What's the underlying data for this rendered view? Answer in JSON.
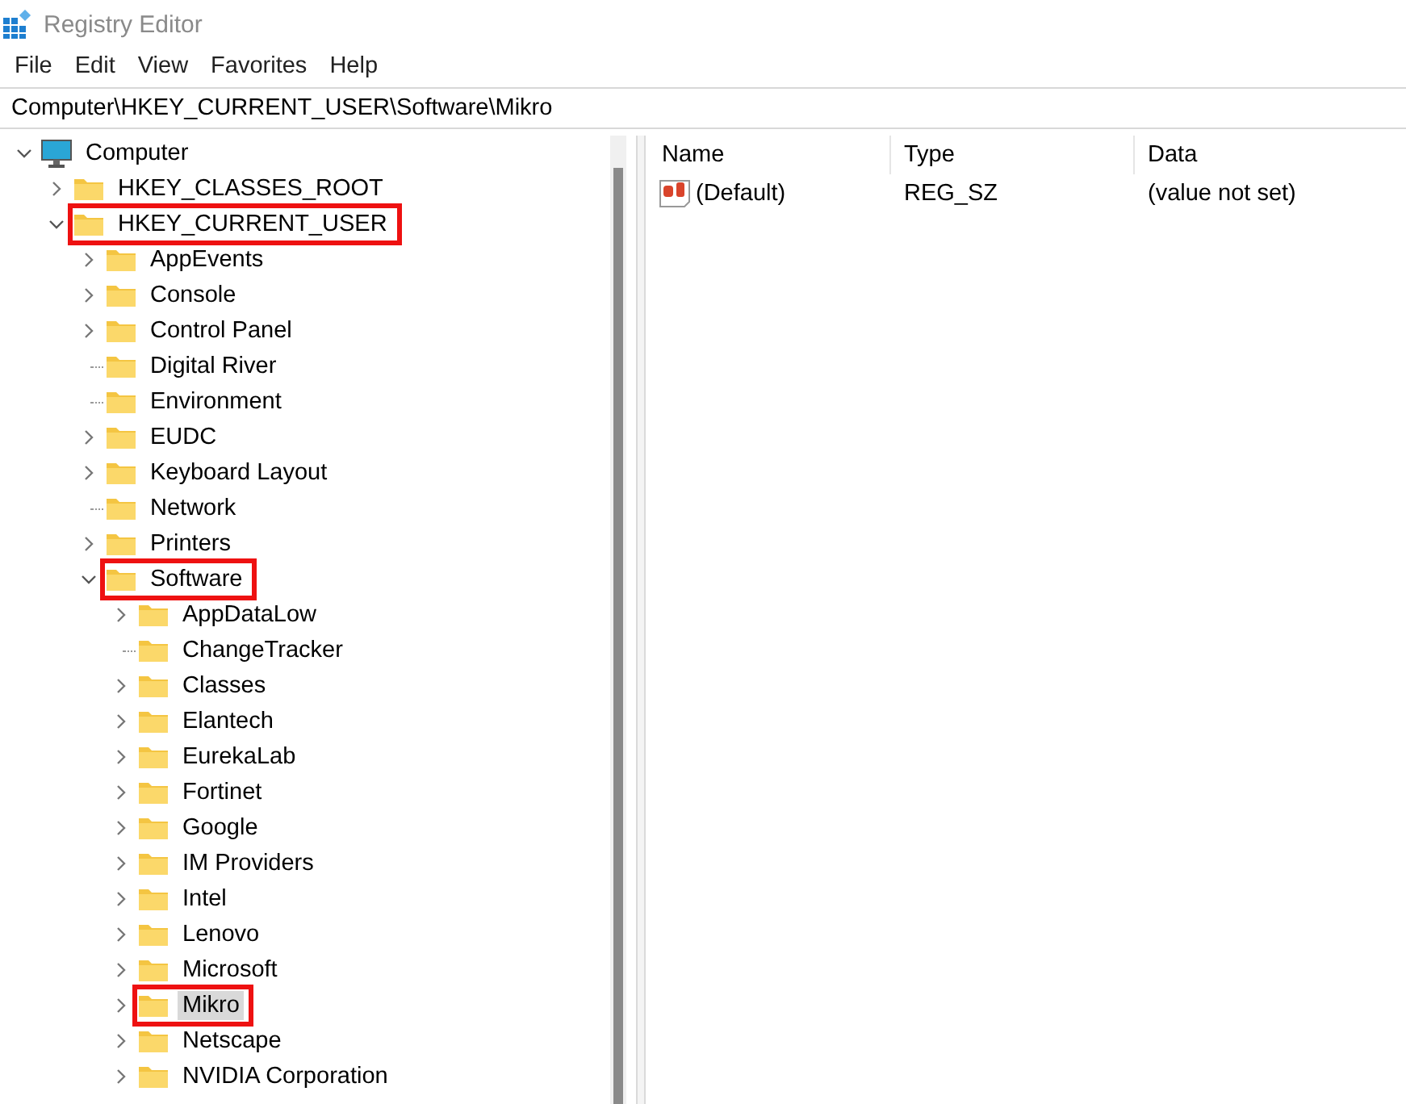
{
  "window": {
    "title": "Registry Editor"
  },
  "menu": [
    "File",
    "Edit",
    "View",
    "Favorites",
    "Help"
  ],
  "address": "Computer\\HKEY_CURRENT_USER\\Software\\Mikro",
  "tree": [
    {
      "label": "Computer",
      "kind": "computer",
      "expandable": true,
      "expanded": true,
      "selected": false,
      "highlighted": false,
      "children": [
        {
          "label": "HKEY_CLASSES_ROOT",
          "kind": "folder",
          "expandable": true,
          "expanded": false,
          "selected": false,
          "highlighted": false
        },
        {
          "label": "HKEY_CURRENT_USER",
          "kind": "folder",
          "expandable": true,
          "expanded": true,
          "selected": false,
          "highlighted": true,
          "children": [
            {
              "label": "AppEvents",
              "kind": "folder",
              "expandable": true,
              "expanded": false,
              "selected": false,
              "highlighted": false
            },
            {
              "label": "Console",
              "kind": "folder",
              "expandable": true,
              "expanded": false,
              "selected": false,
              "highlighted": false
            },
            {
              "label": "Control Panel",
              "kind": "folder",
              "expandable": true,
              "expanded": false,
              "selected": false,
              "highlighted": false
            },
            {
              "label": "Digital River",
              "kind": "folder",
              "expandable": false,
              "expanded": false,
              "selected": false,
              "highlighted": false
            },
            {
              "label": "Environment",
              "kind": "folder",
              "expandable": false,
              "expanded": false,
              "selected": false,
              "highlighted": false
            },
            {
              "label": "EUDC",
              "kind": "folder",
              "expandable": true,
              "expanded": false,
              "selected": false,
              "highlighted": false
            },
            {
              "label": "Keyboard Layout",
              "kind": "folder",
              "expandable": true,
              "expanded": false,
              "selected": false,
              "highlighted": false
            },
            {
              "label": "Network",
              "kind": "folder",
              "expandable": false,
              "expanded": false,
              "selected": false,
              "highlighted": false
            },
            {
              "label": "Printers",
              "kind": "folder",
              "expandable": true,
              "expanded": false,
              "selected": false,
              "highlighted": false
            },
            {
              "label": "Software",
              "kind": "folder",
              "expandable": true,
              "expanded": true,
              "selected": false,
              "highlighted": true,
              "children": [
                {
                  "label": "AppDataLow",
                  "kind": "folder",
                  "expandable": true,
                  "expanded": false,
                  "selected": false,
                  "highlighted": false
                },
                {
                  "label": "ChangeTracker",
                  "kind": "folder",
                  "expandable": false,
                  "expanded": false,
                  "selected": false,
                  "highlighted": false
                },
                {
                  "label": "Classes",
                  "kind": "folder",
                  "expandable": true,
                  "expanded": false,
                  "selected": false,
                  "highlighted": false
                },
                {
                  "label": "Elantech",
                  "kind": "folder",
                  "expandable": true,
                  "expanded": false,
                  "selected": false,
                  "highlighted": false
                },
                {
                  "label": "EurekaLab",
                  "kind": "folder",
                  "expandable": true,
                  "expanded": false,
                  "selected": false,
                  "highlighted": false
                },
                {
                  "label": "Fortinet",
                  "kind": "folder",
                  "expandable": true,
                  "expanded": false,
                  "selected": false,
                  "highlighted": false
                },
                {
                  "label": "Google",
                  "kind": "folder",
                  "expandable": true,
                  "expanded": false,
                  "selected": false,
                  "highlighted": false
                },
                {
                  "label": "IM Providers",
                  "kind": "folder",
                  "expandable": true,
                  "expanded": false,
                  "selected": false,
                  "highlighted": false
                },
                {
                  "label": "Intel",
                  "kind": "folder",
                  "expandable": true,
                  "expanded": false,
                  "selected": false,
                  "highlighted": false
                },
                {
                  "label": "Lenovo",
                  "kind": "folder",
                  "expandable": true,
                  "expanded": false,
                  "selected": false,
                  "highlighted": false
                },
                {
                  "label": "Microsoft",
                  "kind": "folder",
                  "expandable": true,
                  "expanded": false,
                  "selected": false,
                  "highlighted": false
                },
                {
                  "label": "Mikro",
                  "kind": "folder",
                  "expandable": true,
                  "expanded": false,
                  "selected": true,
                  "highlighted": true
                },
                {
                  "label": "Netscape",
                  "kind": "folder",
                  "expandable": true,
                  "expanded": false,
                  "selected": false,
                  "highlighted": false
                },
                {
                  "label": "NVIDIA Corporation",
                  "kind": "folder",
                  "expandable": true,
                  "expanded": false,
                  "selected": false,
                  "highlighted": false
                }
              ]
            }
          ]
        }
      ]
    }
  ],
  "values": {
    "columns": [
      "Name",
      "Type",
      "Data"
    ],
    "rows": [
      {
        "kind": "string",
        "name": "(Default)",
        "type": "REG_SZ",
        "data": "(value not set)"
      }
    ]
  }
}
